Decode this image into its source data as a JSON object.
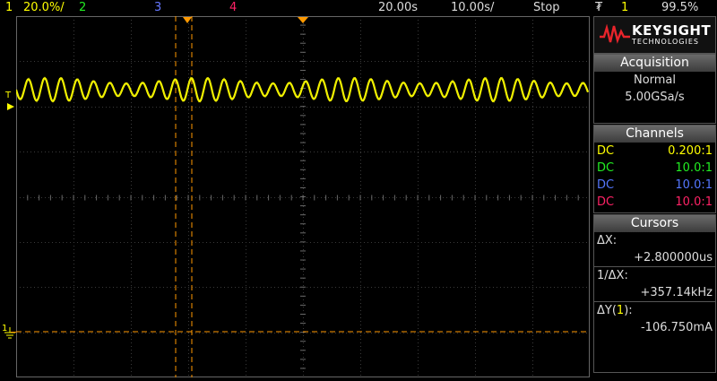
{
  "topbar": {
    "ch1_num": "1",
    "ch1_scale": "20.0%/",
    "ch2_num": "2",
    "ch3_num": "3",
    "ch4_num": "4",
    "time_delay": "20.00s",
    "time_scale": "10.00s/",
    "run_state": "Stop",
    "trigger_symbol": "₮",
    "trigger_channel": "1",
    "trigger_level": "99.5%"
  },
  "brand": {
    "name": "KEYSIGHT",
    "sub": "TECHNOLOGIES"
  },
  "acquisition": {
    "title": "Acquisition",
    "mode": "Normal",
    "rate": "5.00GSa/s"
  },
  "channels": {
    "title": "Channels",
    "rows": [
      {
        "coupling": "DC",
        "probe": "0.200:1",
        "color": "#ffff00"
      },
      {
        "coupling": "DC",
        "probe": "10.0:1",
        "color": "#22ee22"
      },
      {
        "coupling": "DC",
        "probe": "10.0:1",
        "color": "#5577ff"
      },
      {
        "coupling": "DC",
        "probe": "10.0:1",
        "color": "#ff2266"
      }
    ]
  },
  "cursors": {
    "title": "Cursors",
    "dx_label": "ΔX:",
    "dx_value": "+2.800000us",
    "inv_label": "1/ΔX:",
    "inv_value": "+357.14kHz",
    "dy_label_pre": "ΔY(",
    "dy_label_ch": "1",
    "dy_label_post": "):",
    "dy_value": "-106.750mA"
  },
  "screen": {
    "ground_marker": "1",
    "trigger_marker": "T"
  },
  "colors": {
    "ch1": "#ffff00",
    "ch2": "#22ee22",
    "ch3": "#5577ff",
    "ch4": "#ff2266",
    "cursor": "#ff9900"
  }
}
